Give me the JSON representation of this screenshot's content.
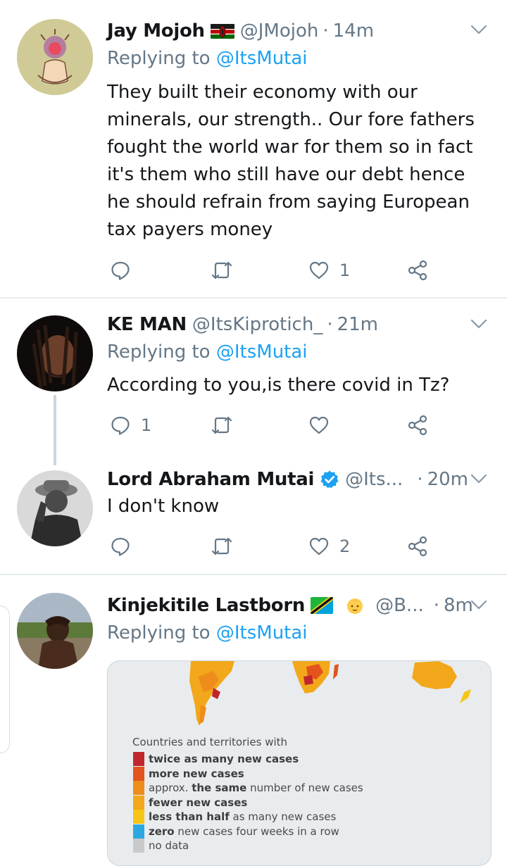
{
  "colors": {
    "accent": "#1da1f2",
    "muted": "#657786",
    "text": "#14171a",
    "verified": "#1da1f2",
    "legend_twice": "#c0272d",
    "legend_more": "#e2541c",
    "legend_same": "#ee8d1c",
    "legend_fewer": "#f2a81a",
    "legend_less_half": "#f5c518",
    "legend_zero": "#2ba8e0",
    "legend_no_data": "#c9c9c9"
  },
  "tweets": [
    {
      "name": "Jay Mojoh",
      "flag": "kenya-flag",
      "handle": "@JMojoh",
      "sep": "·",
      "time": "14m",
      "replying_prefix": "Replying to ",
      "replying_to": "@ItsMutai",
      "text": "They built their economy with our minerals, our strength.. Our fore fathers fought the world war for them so in fact it's them who still have our debt hence he should refrain from saying European tax payers money",
      "reply_count": "",
      "retweet_count": "",
      "like_count": "1"
    },
    {
      "name": "KE MAN",
      "handle": "@ItsKiprotich_",
      "sep": "·",
      "time": "21m",
      "replying_prefix": "Replying to ",
      "replying_to": "@ItsMutai",
      "text": "According to you,is there covid in Tz?",
      "reply_count": "1",
      "retweet_count": "",
      "like_count": ""
    },
    {
      "name": "Lord Abraham Mutai",
      "verified": true,
      "handle": "@Its...",
      "sep": "·",
      "time": "20m",
      "text": "I don't know",
      "reply_count": "",
      "retweet_count": "",
      "like_count": "2"
    },
    {
      "name": "Kinjekitile Lastborn",
      "flag": "tanzania-flag",
      "emoji": "baby-emoji",
      "handle": "@B...",
      "sep": "·",
      "time": "8m",
      "replying_prefix": "Replying to ",
      "replying_to": "@ItsMutai"
    }
  ],
  "media_legend": {
    "title": "Countries and territories with",
    "items": [
      {
        "bold": "twice as many new cases",
        "rest": ""
      },
      {
        "bold": "more new cases",
        "rest": ""
      },
      {
        "pre": "approx. ",
        "bold": "the same",
        "rest": " number of new cases"
      },
      {
        "bold": "fewer new cases",
        "rest": ""
      },
      {
        "bold": "less than half",
        "rest": " as many new cases"
      },
      {
        "bold": "zero",
        "rest": " new cases four weeks in a row"
      },
      {
        "bold": "",
        "rest": "no data"
      }
    ]
  }
}
